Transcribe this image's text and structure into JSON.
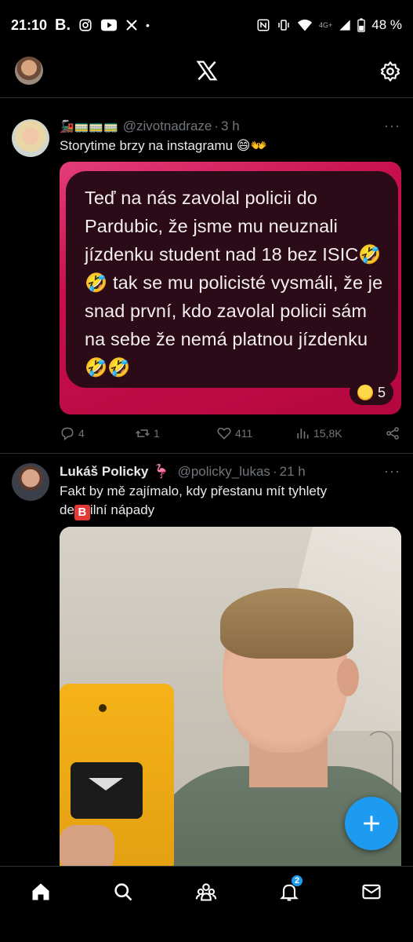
{
  "status_bar": {
    "time": "21:10",
    "app_letter": "B.",
    "network": "4G+",
    "battery": "48 %"
  },
  "tweets": [
    {
      "emoji_name": "🚂🚃🚃🚃",
      "handle": "@zivotnadraze",
      "time": "3 h",
      "text": "Storytime brzy na instagramu 😄👐",
      "media_text": "Teď na nás zavolal policii do Pardubic, že jsme mu neuznali jízdenku student nad 18 bez ISIC🤣🤣 tak se mu policisté vysmáli, že je snad první, kdo zavolal policii sám na sebe že nemá platnou jízdenku 🤣🤣",
      "media_reaction_count": "5",
      "replies": "4",
      "reposts": "1",
      "likes": "411",
      "views": "15,8K"
    },
    {
      "name": "Lukáš Policky",
      "name_emoji": "🦩",
      "handle": "@policky_lukas",
      "time": "21 h",
      "text_line1": "Fakt by mě zajímalo, kdy přestanu mít tyhlety",
      "text_line2_pre": "de",
      "text_line2_badge": "B",
      "text_line2_post": "ilní nápady"
    }
  ],
  "bottom_nav": {
    "notifications_badge": "2"
  },
  "colors": {
    "accent": "#1d9bf0",
    "muted": "#71767b",
    "divider": "#2f3336"
  }
}
